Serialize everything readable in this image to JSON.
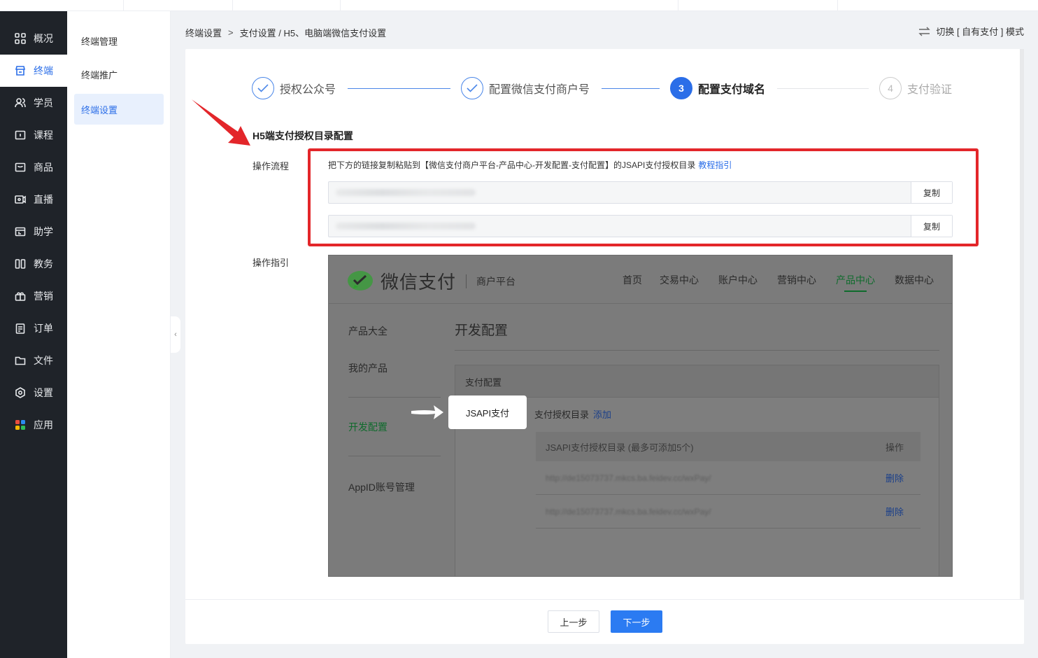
{
  "nav": {
    "items": [
      {
        "label": "概况",
        "icon": "dashboard-icon"
      },
      {
        "label": "终端",
        "icon": "store-icon"
      },
      {
        "label": "学员",
        "icon": "users-icon"
      },
      {
        "label": "课程",
        "icon": "course-icon"
      },
      {
        "label": "商品",
        "icon": "goods-icon"
      },
      {
        "label": "直播",
        "icon": "live-icon"
      },
      {
        "label": "助学",
        "icon": "study-icon"
      },
      {
        "label": "教务",
        "icon": "book-icon"
      },
      {
        "label": "营销",
        "icon": "gift-icon"
      },
      {
        "label": "订单",
        "icon": "order-icon"
      },
      {
        "label": "文件",
        "icon": "folder-icon"
      },
      {
        "label": "设置",
        "icon": "gear-icon"
      },
      {
        "label": "应用",
        "icon": "apps-icon"
      }
    ],
    "active": "终端"
  },
  "subnav": {
    "items": [
      "终端管理",
      "终端推广",
      "终端设置"
    ],
    "active": "终端设置"
  },
  "breadcrumb": {
    "root": "终端设置",
    "path": "支付设置 / H5、电脑端微信支付设置"
  },
  "mode_switch": "切换 [ 自有支付 ] 模式",
  "steps": [
    {
      "num": "1",
      "label": "授权公众号",
      "state": "done"
    },
    {
      "num": "2",
      "label": "配置微信支付商户号",
      "state": "done"
    },
    {
      "num": "3",
      "label": "配置支付域名",
      "state": "current"
    },
    {
      "num": "4",
      "label": "支付验证",
      "state": "todo"
    }
  ],
  "section_title": "H5端支付授权目录配置",
  "flow": {
    "label": "操作流程",
    "instruction": "把下方的链接复制粘贴到【微信支付商户平台-产品中心-开发配置-支付配置】的JSAPI支付授权目录",
    "tutorial_link": "教程指引",
    "copy_label": "复制"
  },
  "guide": {
    "label": "操作指引",
    "brand": "微信支付",
    "platform": "商户平台",
    "menu": [
      "首页",
      "交易中心",
      "账户中心",
      "营销中心",
      "产品中心",
      "数据中心"
    ],
    "menu_active": "产品中心",
    "left_menu": [
      "产品大全",
      "我的产品",
      "开发配置",
      "AppID账号管理"
    ],
    "left_active": "开发配置",
    "title": "开发配置",
    "panel_title": "支付配置",
    "jsapi_label": "JSAPI支付",
    "auth_dir_label": "支付授权目录",
    "add_label": "添加",
    "table_header": "JSAPI支付授权目录 (最多可添加5个)",
    "table_action": "操作",
    "rows": [
      {
        "url": "http://de15073737.mkcs.ba.feidev.cc/wxPay/",
        "action": "删除"
      },
      {
        "url": "http://de15073737.mkcs.ba.feidev.cc/wxPay/",
        "action": "删除"
      }
    ]
  },
  "footer": {
    "prev": "上一步",
    "next": "下一步"
  },
  "colors": {
    "primary": "#2b6ee8",
    "annotation_red": "#e3262a",
    "wechat_green": "#1aad19"
  }
}
